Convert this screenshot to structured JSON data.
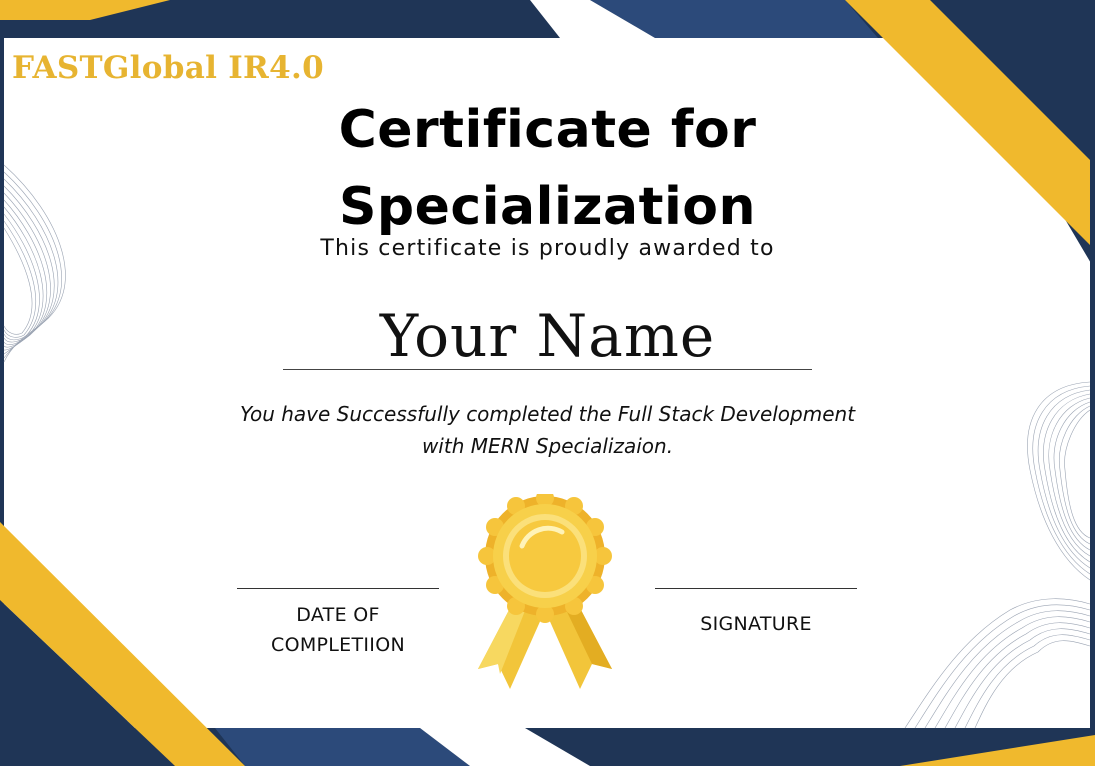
{
  "brand": {
    "name": "FASTGlobal IR4.0"
  },
  "certificate": {
    "title_line1": "Certificate for",
    "title_line2": "Specialization",
    "awarded_text": "This certificate is proudly awarded to",
    "recipient_name": "Your Name",
    "description_line1": "You have Successfully completed the Full Stack Development",
    "description_line2": "with MERN Specializaion.",
    "date_label_line1": "DATE OF",
    "date_label_line2": "COMPLETIION",
    "signature_label": "SIGNATURE"
  },
  "colors": {
    "navy": "#1f3556",
    "blue": "#2c4a7a",
    "gold": "#f0b92d",
    "brand_text": "#e7b431"
  },
  "decorations": {
    "badge_icon": "award-rosette-icon",
    "wave_pattern": "line-wave-pattern"
  }
}
